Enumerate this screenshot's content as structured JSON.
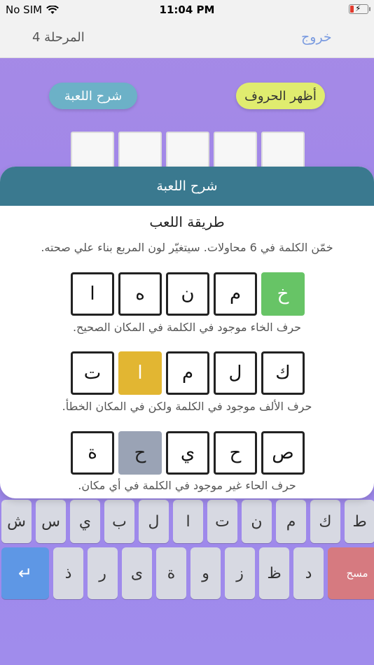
{
  "status_bar": {
    "carrier": "No SIM",
    "time": "11:04 PM"
  },
  "nav": {
    "exit_label": "خروج",
    "level_label": "المرحلة 4"
  },
  "buttons": {
    "reveal_letters": "أظهر الحروف",
    "game_explanation": "شرح اللعبة"
  },
  "modal": {
    "header": "شرح اللعبة",
    "title": "طريقة اللعب",
    "intro": "خمّن الكلمة في  6  محاولات. سيتغيّر لون المربع بناء علي صحته.",
    "examples": [
      {
        "letters": [
          "خ",
          "م",
          "ن",
          "ه",
          "ا"
        ],
        "states": [
          "correct",
          "absent",
          "absent",
          "absent",
          "absent"
        ],
        "description": "حرف الخاء موجود في الكلمة في المكان الصحيح."
      },
      {
        "letters": [
          "ك",
          "ل",
          "م",
          "ا",
          "ت"
        ],
        "states": [
          "absent",
          "absent",
          "absent",
          "present",
          "absent"
        ],
        "description": "حرف الألف موجود في الكلمة ولكن في المكان الخطأ."
      },
      {
        "letters": [
          "ص",
          "ح",
          "ي",
          "ح",
          "ة"
        ],
        "states": [
          "absent",
          "absent",
          "absent",
          "wrong",
          "absent"
        ],
        "description": "حرف الحاء غير موجود في الكلمة في أي مكان."
      }
    ]
  },
  "keyboard": {
    "row1": [
      "ط",
      "ك",
      "م",
      "ن",
      "ت",
      "ا",
      "ل",
      "ب",
      "ي",
      "س",
      "ش"
    ],
    "row2": [
      "د",
      "ظ",
      "ز",
      "و",
      "ة",
      "ى",
      "ر",
      "ذ"
    ],
    "delete_label": "مسح",
    "enter_symbol": "↵"
  },
  "colors": {
    "correct": "#67c466",
    "present": "#e2b632",
    "wrong": "#9aa3b5",
    "header": "#3a798f"
  }
}
